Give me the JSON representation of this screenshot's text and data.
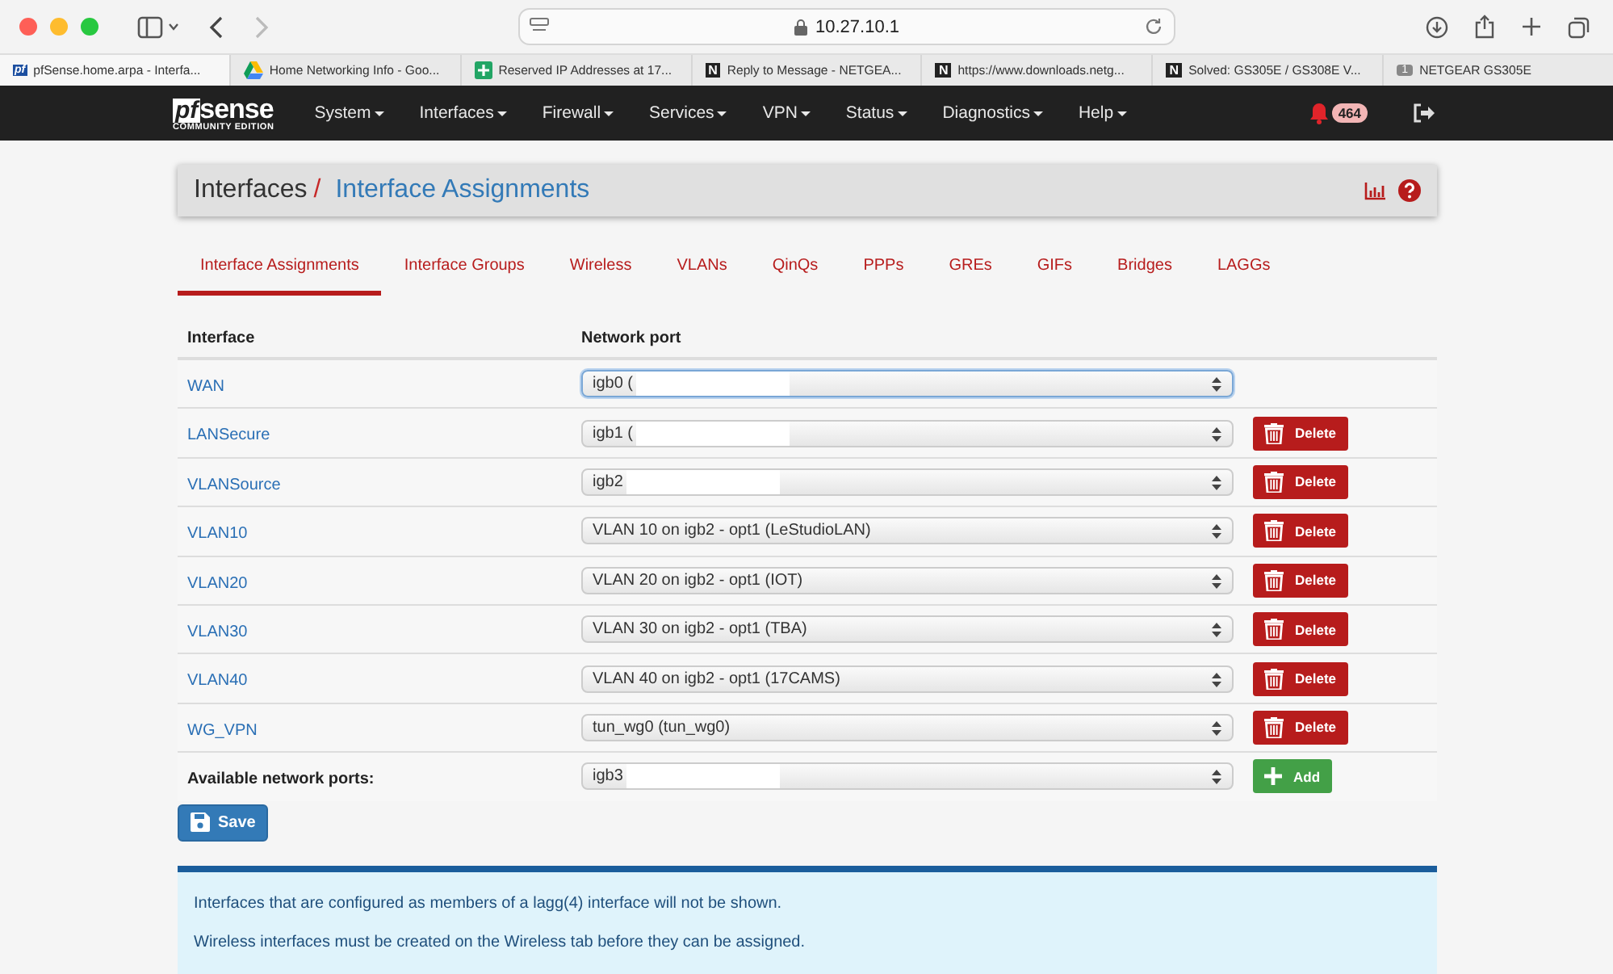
{
  "browser": {
    "address": "10.27.10.1",
    "tabs": [
      {
        "title": "pfSense.home.arpa - Interfa...",
        "kind": "pf",
        "selected": true
      },
      {
        "title": "Home Networking Info - Goo...",
        "kind": "drive",
        "selected": false
      },
      {
        "title": "Reserved IP Addresses at 17...",
        "kind": "sheet",
        "selected": false
      },
      {
        "title": "Reply to Message - NETGEA...",
        "kind": "N",
        "selected": false
      },
      {
        "title": "https://www.downloads.netg...",
        "kind": "N",
        "selected": false
      },
      {
        "title": "Solved: GS305E / GS308E V...",
        "kind": "N",
        "selected": false
      },
      {
        "title": "NETGEAR GS305E",
        "kind": "1",
        "selected": false
      }
    ]
  },
  "navbar": {
    "logo_text": "sense",
    "logo_mark": "pf",
    "logo_sub": "COMMUNITY EDITION",
    "menus": [
      "System",
      "Interfaces",
      "Firewall",
      "Services",
      "VPN",
      "Status",
      "Diagnostics",
      "Help"
    ],
    "notifications": "464"
  },
  "breadcrumb": {
    "parent": "Interfaces",
    "separator": "/",
    "current": "Interface Assignments"
  },
  "tabs": [
    {
      "label": "Interface Assignments",
      "selected": true
    },
    {
      "label": "Interface Groups",
      "selected": false
    },
    {
      "label": "Wireless",
      "selected": false
    },
    {
      "label": "VLANs",
      "selected": false
    },
    {
      "label": "QinQs",
      "selected": false
    },
    {
      "label": "PPPs",
      "selected": false
    },
    {
      "label": "GREs",
      "selected": false
    },
    {
      "label": "GIFs",
      "selected": false
    },
    {
      "label": "Bridges",
      "selected": false
    },
    {
      "label": "LAGGs",
      "selected": false
    }
  ],
  "table": {
    "columns": [
      "Interface",
      "Network port"
    ],
    "rows": [
      {
        "interface": "WAN",
        "port": "igb0 (",
        "redacted": true,
        "focused": true
      },
      {
        "interface": "LANSecure",
        "port": "igb1 (",
        "redacted": true,
        "focused": false,
        "action": "Delete"
      },
      {
        "interface": "VLANSource",
        "port": "igb2",
        "redacted": true,
        "focused": false,
        "action": "Delete"
      },
      {
        "interface": "VLAN10",
        "port": "VLAN 10 on igb2 - opt1 (LeStudioLAN)",
        "redacted": false,
        "focused": false,
        "action": "Delete"
      },
      {
        "interface": "VLAN20",
        "port": "VLAN 20 on igb2 - opt1 (IOT)",
        "redacted": false,
        "focused": false,
        "action": "Delete"
      },
      {
        "interface": "VLAN30",
        "port": "VLAN 30 on igb2 - opt1 (TBA)",
        "redacted": false,
        "focused": false,
        "action": "Delete"
      },
      {
        "interface": "VLAN40",
        "port": "VLAN 40 on igb2 - opt1 (17CAMS)",
        "redacted": false,
        "focused": false,
        "action": "Delete"
      },
      {
        "interface": "WG_VPN",
        "port": "tun_wg0 (tun_wg0)",
        "redacted": false,
        "focused": false,
        "action": "Delete"
      }
    ],
    "available": {
      "label": "Available network ports:",
      "port": "igb3",
      "redacted": true,
      "action": "Add"
    }
  },
  "save_button": "Save",
  "info": [
    "Interfaces that are configured as members of a lagg(4) interface will not be shown.",
    "Wireless interfaces must be created on the Wireless tab before they can be assigned."
  ]
}
